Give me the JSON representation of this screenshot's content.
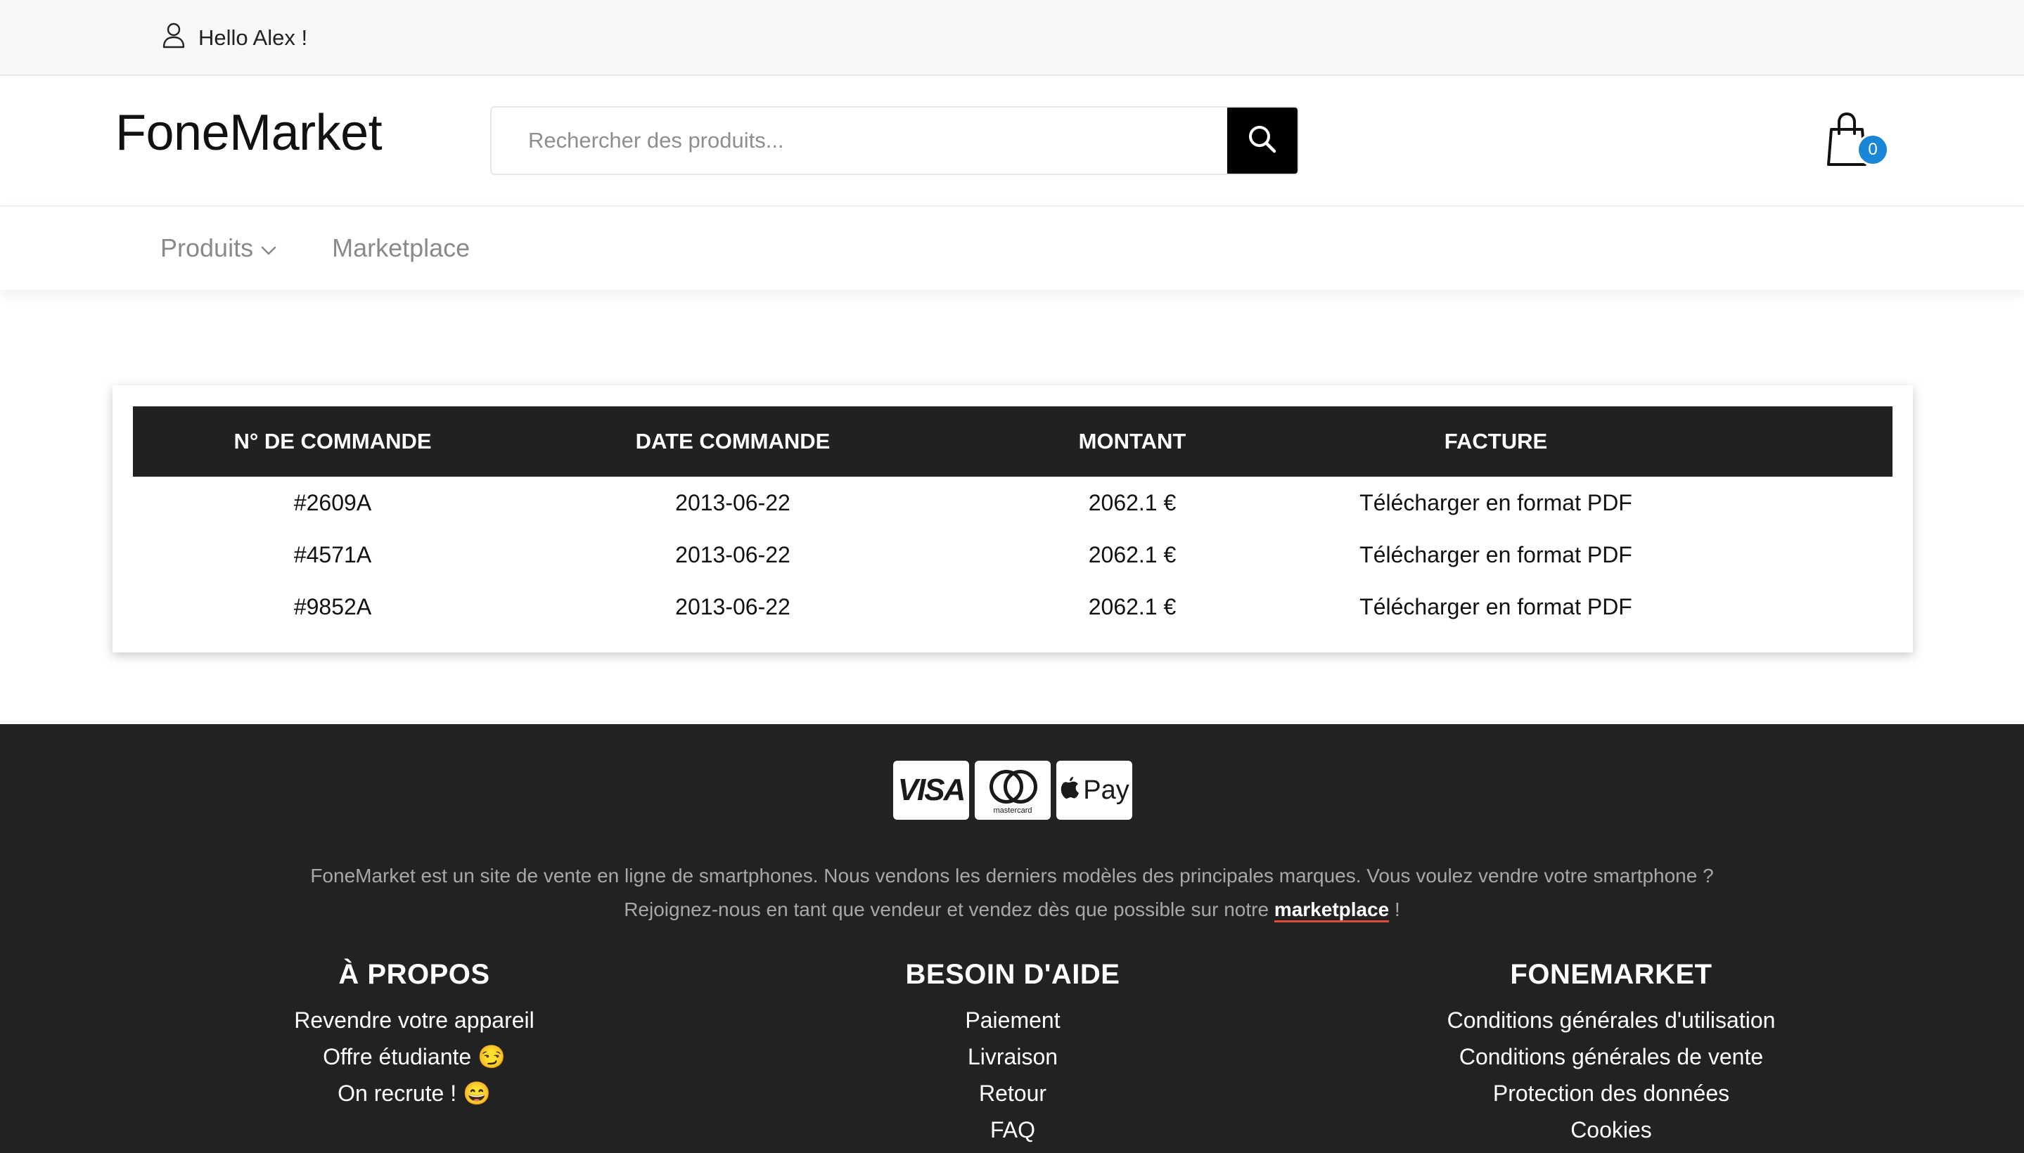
{
  "topbar": {
    "greeting": "Hello Alex !",
    "user_icon": "user-icon"
  },
  "header": {
    "logo": "FoneMarket",
    "search_placeholder": "Rechercher des produits...",
    "search_icon": "search-icon",
    "cart_icon": "shopping-bag-icon",
    "cart_count": "0"
  },
  "nav": {
    "items": [
      {
        "label": "Produits",
        "has_dropdown": true
      },
      {
        "label": "Marketplace",
        "has_dropdown": false
      }
    ]
  },
  "orders": {
    "columns": [
      "N° DE COMMANDE",
      "DATE COMMANDE",
      "MONTANT",
      "FACTURE"
    ],
    "rows": [
      {
        "id": "#2609A",
        "date": "2013-06-22",
        "amount": "2062.1 €",
        "invoice": "Télécharger en format PDF"
      },
      {
        "id": "#4571A",
        "date": "2013-06-22",
        "amount": "2062.1 €",
        "invoice": "Télécharger en format PDF"
      },
      {
        "id": "#9852A",
        "date": "2013-06-22",
        "amount": "2062.1 €",
        "invoice": "Télécharger en format PDF"
      }
    ]
  },
  "footer": {
    "payments": {
      "visa": "VISA",
      "mastercard": "mastercard",
      "applepay": "Pay"
    },
    "about_line1": "FoneMarket est un site de vente en ligne de smartphones. Nous vendons les derniers modèles des principales marques. Vous voulez vendre votre smartphone ?",
    "about_line2_before": "Rejoignez-nous en tant que vendeur et vendez dès que possible sur notre ",
    "about_link": "marketplace",
    "about_line2_after": " !",
    "columns": [
      {
        "title": "À PROPOS",
        "links": [
          "Revendre votre appareil",
          "Offre étudiante 😏",
          "On recrute ! 😄"
        ]
      },
      {
        "title": "BESOIN D'AIDE",
        "links": [
          "Paiement",
          "Livraison",
          "Retour",
          "FAQ"
        ]
      },
      {
        "title": "FONEMARKET",
        "links": [
          "Conditions générales d'utilisation",
          "Conditions générales de vente",
          "Protection des données",
          "Cookies"
        ]
      }
    ]
  },
  "colors": {
    "dark": "#222222",
    "badge": "#1a86d8",
    "link_underline": "#e04b3a"
  }
}
